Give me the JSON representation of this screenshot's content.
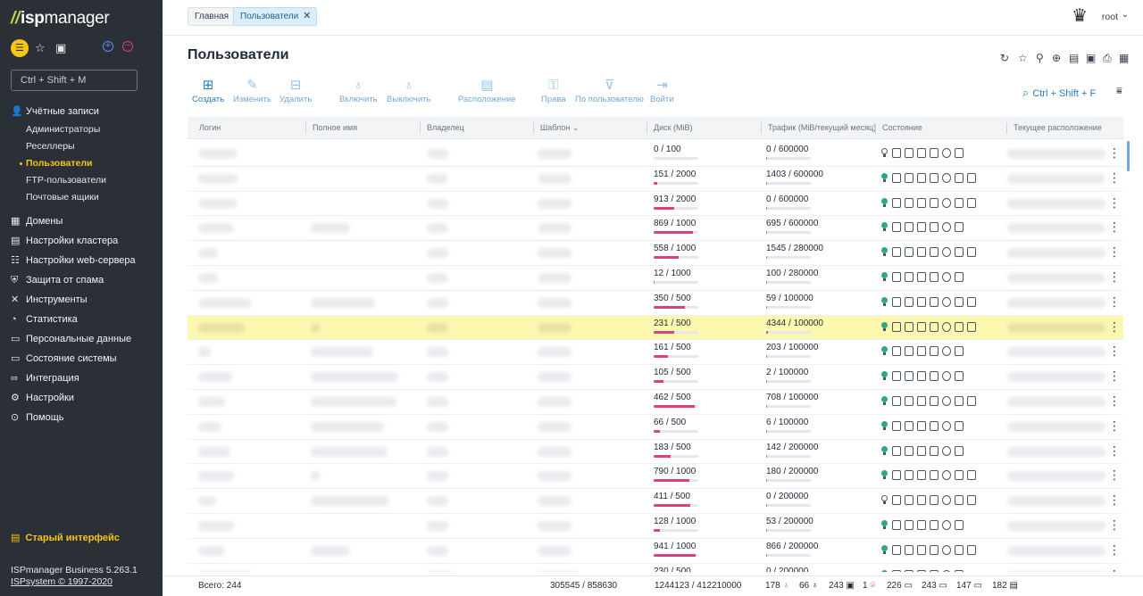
{
  "app": {
    "logo_prefix": "//",
    "logo_isp": "isp",
    "logo_manager": "manager",
    "search_placeholder": "Ctrl + Shift + M",
    "old_interface": "Старый интерфейс",
    "version": "ISPmanager Business 5.263.1",
    "copyright": "ISPsystem © 1997-2020"
  },
  "nav": {
    "accounts": "Учётные записи",
    "admins": "Администраторы",
    "resellers": "Реселлеры",
    "users": "Пользователи",
    "ftp_users": "FTP-пользователи",
    "mailboxes": "Почтовые ящики",
    "domains": "Домены",
    "cluster": "Настройки кластера",
    "webserver": "Настройки web-сервера",
    "spam": "Защита от спама",
    "tools": "Инструменты",
    "stats": "Статистика",
    "personal": "Персональные данные",
    "system_state": "Состояние системы",
    "integration": "Интеграция",
    "settings": "Настройки",
    "help": "Помощь"
  },
  "tabs": {
    "home": "Главная",
    "users": "Пользователи"
  },
  "user": {
    "name": "root"
  },
  "page": {
    "title": "Пользователи",
    "search_hint": "Ctrl + Shift + F"
  },
  "toolbar": {
    "create": "Создать",
    "edit": "Изменить",
    "delete": "Удалить",
    "enable": "Включить",
    "disable": "Выключить",
    "location": "Расположение",
    "rights": "Права",
    "by_user": "По пользователю",
    "login_as": "Войти"
  },
  "table": {
    "headers": {
      "login": "Логин",
      "fullname": "Полное имя",
      "owner": "Владелец",
      "template": "Шаблон",
      "disk": "Диск (MiB)",
      "traffic": "Трафик (MiB/текущий месяц)",
      "state": "Состояние",
      "location": "Текущее расположение"
    },
    "rows": [
      {
        "disk": "0 / 100",
        "disk_pct": 0,
        "traffic": "0 / 600000",
        "traffic_pct": 0,
        "on": false,
        "hl": false
      },
      {
        "disk": "151 / 2000",
        "disk_pct": 8,
        "traffic": "1403 / 600000",
        "traffic_pct": 1,
        "on": true,
        "hl": false
      },
      {
        "disk": "913 / 2000",
        "disk_pct": 46,
        "traffic": "0 / 600000",
        "traffic_pct": 0,
        "on": true,
        "hl": false
      },
      {
        "disk": "869 / 1000",
        "disk_pct": 87,
        "traffic": "695 / 600000",
        "traffic_pct": 1,
        "on": true,
        "hl": false
      },
      {
        "disk": "558 / 1000",
        "disk_pct": 56,
        "traffic": "1545 / 280000",
        "traffic_pct": 1,
        "on": true,
        "hl": false
      },
      {
        "disk": "12 / 1000",
        "disk_pct": 1,
        "traffic": "100 / 280000",
        "traffic_pct": 0,
        "on": true,
        "hl": false
      },
      {
        "disk": "350 / 500",
        "disk_pct": 70,
        "traffic": "59 / 100000",
        "traffic_pct": 0,
        "on": true,
        "hl": false
      },
      {
        "disk": "231 / 500",
        "disk_pct": 46,
        "traffic": "4344 / 100000",
        "traffic_pct": 4,
        "on": true,
        "hl": true
      },
      {
        "disk": "161 / 500",
        "disk_pct": 32,
        "traffic": "203 / 100000",
        "traffic_pct": 0,
        "on": true,
        "hl": false
      },
      {
        "disk": "105 / 500",
        "disk_pct": 21,
        "traffic": "2 / 100000",
        "traffic_pct": 0,
        "on": true,
        "hl": false
      },
      {
        "disk": "462 / 500",
        "disk_pct": 92,
        "traffic": "708 / 100000",
        "traffic_pct": 1,
        "on": true,
        "hl": false
      },
      {
        "disk": "66 / 500",
        "disk_pct": 13,
        "traffic": "6 / 100000",
        "traffic_pct": 0,
        "on": true,
        "hl": false
      },
      {
        "disk": "183 / 500",
        "disk_pct": 37,
        "traffic": "142 / 200000",
        "traffic_pct": 0,
        "on": true,
        "hl": false
      },
      {
        "disk": "790 / 1000",
        "disk_pct": 79,
        "traffic": "180 / 200000",
        "traffic_pct": 0,
        "on": true,
        "hl": false
      },
      {
        "disk": "411 / 500",
        "disk_pct": 82,
        "traffic": "0 / 200000",
        "traffic_pct": 0,
        "on": false,
        "hl": false
      },
      {
        "disk": "128 / 1000",
        "disk_pct": 13,
        "traffic": "53 / 200000",
        "traffic_pct": 0,
        "on": true,
        "hl": false
      },
      {
        "disk": "941 / 1000",
        "disk_pct": 94,
        "traffic": "866 / 200000",
        "traffic_pct": 0,
        "on": true,
        "hl": false
      },
      {
        "disk": "230 / 500",
        "disk_pct": 46,
        "traffic": "0 / 200000",
        "traffic_pct": 0,
        "on": true,
        "hl": false
      }
    ]
  },
  "footer": {
    "total": "Всего: 244",
    "disk_total": "305545 / 858630",
    "traffic_total": "1244123 / 412210000",
    "c1": "178",
    "c2": "66",
    "c3": "243",
    "c4": "1",
    "c5": "226",
    "c6": "243",
    "c7": "147",
    "c8": "182"
  },
  "colors": {
    "accent": "#2a7bbf",
    "sidebar": "#2b2f36",
    "active": "#f5c518",
    "disk_bar": "#e0407a",
    "highlight": "#fdf8b0"
  }
}
